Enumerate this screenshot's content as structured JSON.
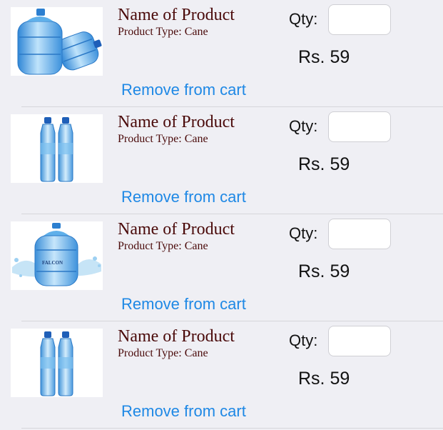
{
  "cart": {
    "items": [
      {
        "name": "Name of Product",
        "type": "Product Type: Cane",
        "qty_label": "Qty:",
        "qty_value": "",
        "price": "Rs. 59",
        "remove_label": "Remove from cart",
        "image": "water-cans-image"
      },
      {
        "name": "Name of Product",
        "type": "Product Type: Cane",
        "qty_label": "Qty:",
        "qty_value": "",
        "price": "Rs. 59",
        "remove_label": "Remove from cart",
        "image": "water-bottles-image"
      },
      {
        "name": "Name of Product",
        "type": "Product Type: Cane",
        "qty_label": "Qty:",
        "qty_value": "",
        "price": "Rs. 59",
        "remove_label": "Remove from cart",
        "image": "water-can-splash-image",
        "image_text": "FALCON"
      },
      {
        "name": "Name of Product",
        "type": "Product Type: Cane",
        "qty_label": "Qty:",
        "qty_value": "",
        "price": "Rs. 59",
        "remove_label": "Remove from cart",
        "image": "water-bottles-image"
      }
    ]
  },
  "colors": {
    "background": "#efeff4",
    "product_text": "#4a0a0a",
    "link_blue": "#1e88e5",
    "water_blue": "#4aa8e6",
    "cap_blue": "#1f5fb8"
  }
}
